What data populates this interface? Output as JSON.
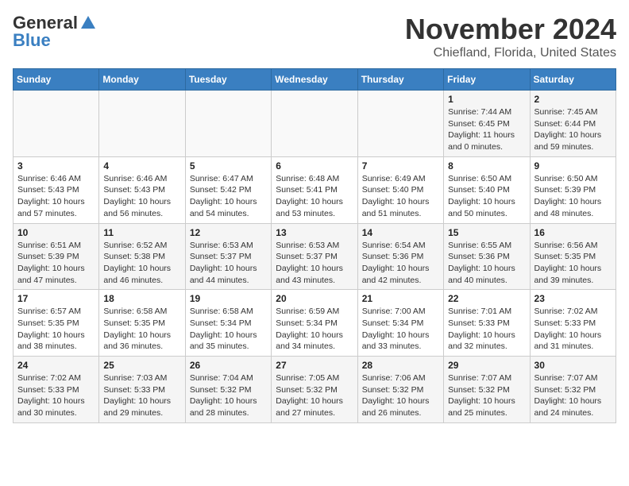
{
  "header": {
    "logo_general": "General",
    "logo_blue": "Blue",
    "title": "November 2024",
    "subtitle": "Chiefland, Florida, United States"
  },
  "days_of_week": [
    "Sunday",
    "Monday",
    "Tuesday",
    "Wednesday",
    "Thursday",
    "Friday",
    "Saturday"
  ],
  "weeks": [
    [
      {
        "day": "",
        "info": ""
      },
      {
        "day": "",
        "info": ""
      },
      {
        "day": "",
        "info": ""
      },
      {
        "day": "",
        "info": ""
      },
      {
        "day": "",
        "info": ""
      },
      {
        "day": "1",
        "info": "Sunrise: 7:44 AM\nSunset: 6:45 PM\nDaylight: 11 hours and 0 minutes."
      },
      {
        "day": "2",
        "info": "Sunrise: 7:45 AM\nSunset: 6:44 PM\nDaylight: 10 hours and 59 minutes."
      }
    ],
    [
      {
        "day": "3",
        "info": "Sunrise: 6:46 AM\nSunset: 5:43 PM\nDaylight: 10 hours and 57 minutes."
      },
      {
        "day": "4",
        "info": "Sunrise: 6:46 AM\nSunset: 5:43 PM\nDaylight: 10 hours and 56 minutes."
      },
      {
        "day": "5",
        "info": "Sunrise: 6:47 AM\nSunset: 5:42 PM\nDaylight: 10 hours and 54 minutes."
      },
      {
        "day": "6",
        "info": "Sunrise: 6:48 AM\nSunset: 5:41 PM\nDaylight: 10 hours and 53 minutes."
      },
      {
        "day": "7",
        "info": "Sunrise: 6:49 AM\nSunset: 5:40 PM\nDaylight: 10 hours and 51 minutes."
      },
      {
        "day": "8",
        "info": "Sunrise: 6:50 AM\nSunset: 5:40 PM\nDaylight: 10 hours and 50 minutes."
      },
      {
        "day": "9",
        "info": "Sunrise: 6:50 AM\nSunset: 5:39 PM\nDaylight: 10 hours and 48 minutes."
      }
    ],
    [
      {
        "day": "10",
        "info": "Sunrise: 6:51 AM\nSunset: 5:39 PM\nDaylight: 10 hours and 47 minutes."
      },
      {
        "day": "11",
        "info": "Sunrise: 6:52 AM\nSunset: 5:38 PM\nDaylight: 10 hours and 46 minutes."
      },
      {
        "day": "12",
        "info": "Sunrise: 6:53 AM\nSunset: 5:37 PM\nDaylight: 10 hours and 44 minutes."
      },
      {
        "day": "13",
        "info": "Sunrise: 6:53 AM\nSunset: 5:37 PM\nDaylight: 10 hours and 43 minutes."
      },
      {
        "day": "14",
        "info": "Sunrise: 6:54 AM\nSunset: 5:36 PM\nDaylight: 10 hours and 42 minutes."
      },
      {
        "day": "15",
        "info": "Sunrise: 6:55 AM\nSunset: 5:36 PM\nDaylight: 10 hours and 40 minutes."
      },
      {
        "day": "16",
        "info": "Sunrise: 6:56 AM\nSunset: 5:35 PM\nDaylight: 10 hours and 39 minutes."
      }
    ],
    [
      {
        "day": "17",
        "info": "Sunrise: 6:57 AM\nSunset: 5:35 PM\nDaylight: 10 hours and 38 minutes."
      },
      {
        "day": "18",
        "info": "Sunrise: 6:58 AM\nSunset: 5:35 PM\nDaylight: 10 hours and 36 minutes."
      },
      {
        "day": "19",
        "info": "Sunrise: 6:58 AM\nSunset: 5:34 PM\nDaylight: 10 hours and 35 minutes."
      },
      {
        "day": "20",
        "info": "Sunrise: 6:59 AM\nSunset: 5:34 PM\nDaylight: 10 hours and 34 minutes."
      },
      {
        "day": "21",
        "info": "Sunrise: 7:00 AM\nSunset: 5:34 PM\nDaylight: 10 hours and 33 minutes."
      },
      {
        "day": "22",
        "info": "Sunrise: 7:01 AM\nSunset: 5:33 PM\nDaylight: 10 hours and 32 minutes."
      },
      {
        "day": "23",
        "info": "Sunrise: 7:02 AM\nSunset: 5:33 PM\nDaylight: 10 hours and 31 minutes."
      }
    ],
    [
      {
        "day": "24",
        "info": "Sunrise: 7:02 AM\nSunset: 5:33 PM\nDaylight: 10 hours and 30 minutes."
      },
      {
        "day": "25",
        "info": "Sunrise: 7:03 AM\nSunset: 5:33 PM\nDaylight: 10 hours and 29 minutes."
      },
      {
        "day": "26",
        "info": "Sunrise: 7:04 AM\nSunset: 5:32 PM\nDaylight: 10 hours and 28 minutes."
      },
      {
        "day": "27",
        "info": "Sunrise: 7:05 AM\nSunset: 5:32 PM\nDaylight: 10 hours and 27 minutes."
      },
      {
        "day": "28",
        "info": "Sunrise: 7:06 AM\nSunset: 5:32 PM\nDaylight: 10 hours and 26 minutes."
      },
      {
        "day": "29",
        "info": "Sunrise: 7:07 AM\nSunset: 5:32 PM\nDaylight: 10 hours and 25 minutes."
      },
      {
        "day": "30",
        "info": "Sunrise: 7:07 AM\nSunset: 5:32 PM\nDaylight: 10 hours and 24 minutes."
      }
    ]
  ]
}
